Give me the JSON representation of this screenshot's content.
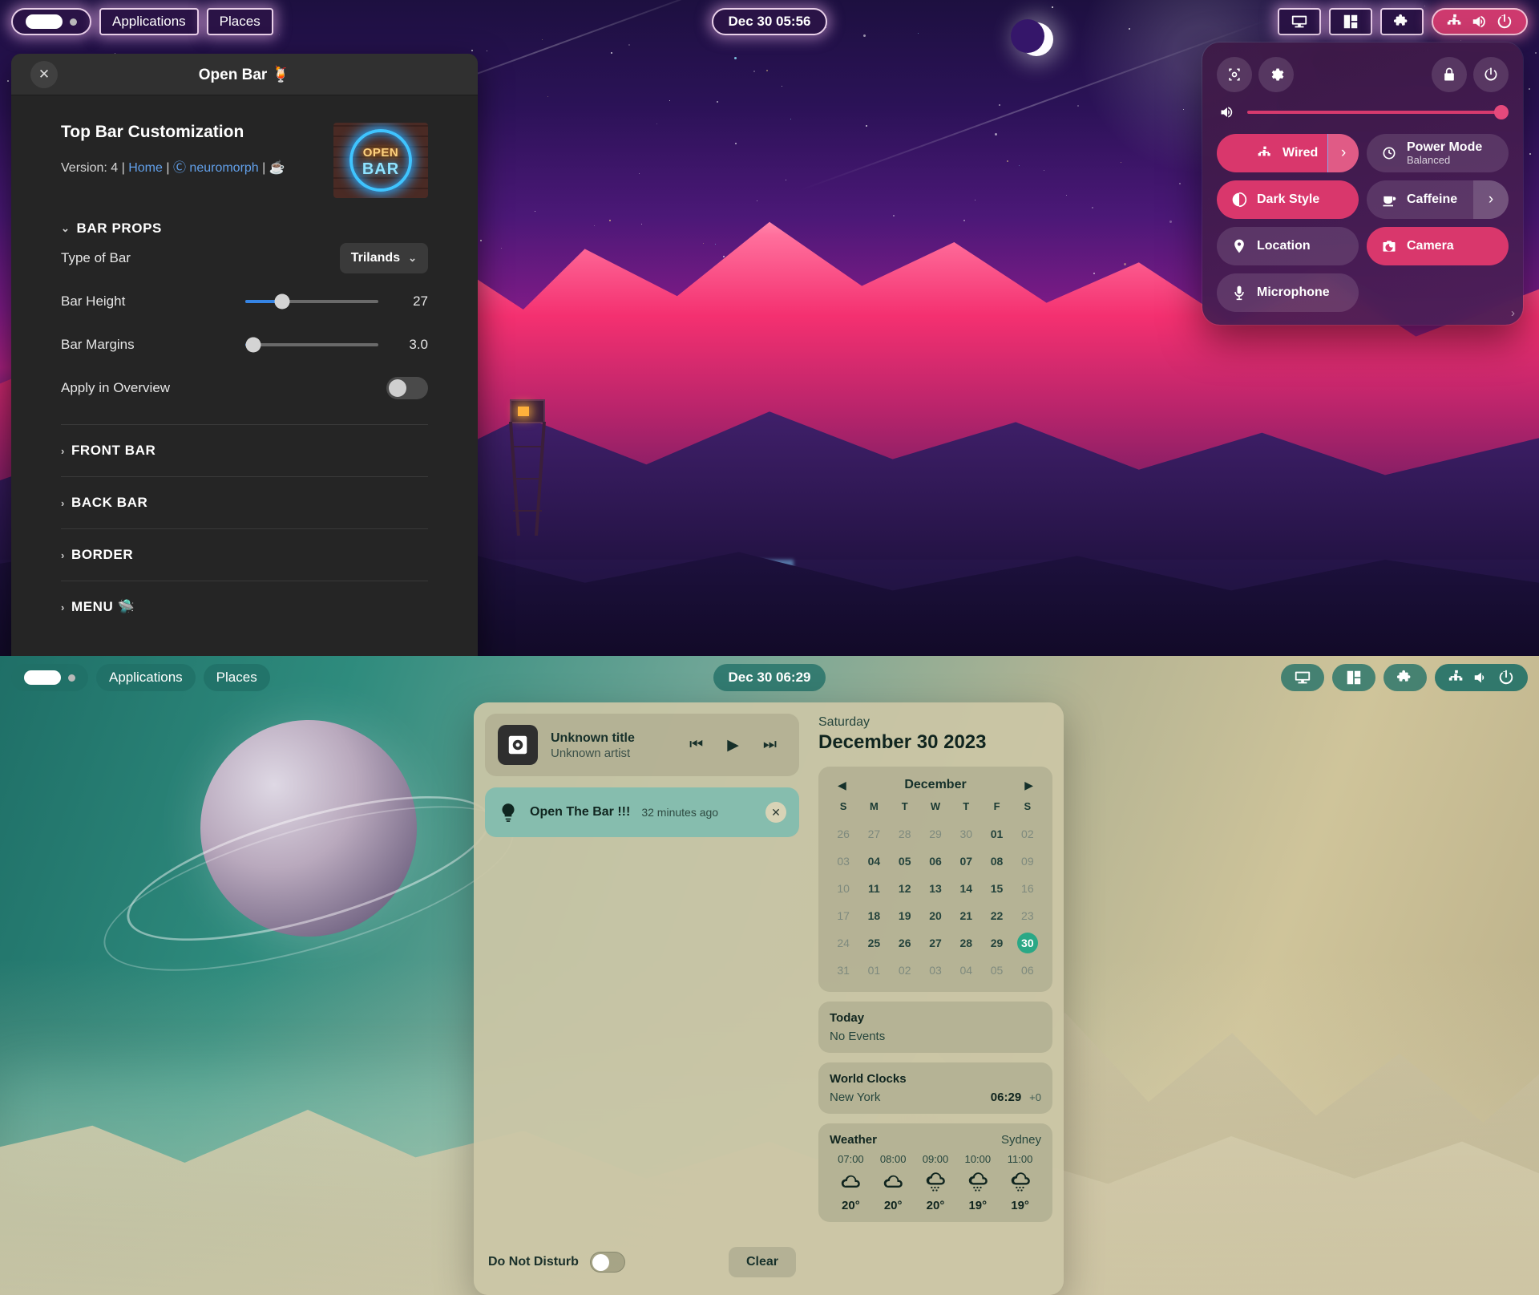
{
  "top_panel": {
    "activities_label": "",
    "applications_label": "Applications",
    "places_label": "Places",
    "clock": "Dec 30  05:56",
    "right_icons": [
      "display-icon",
      "window-layout-icon",
      "extensions-puzzle-icon",
      "wired-network-icon",
      "volume-icon",
      "power-icon"
    ]
  },
  "bottom_panel": {
    "applications_label": "Applications",
    "places_label": "Places",
    "clock": "Dec 30  06:29"
  },
  "openbar": {
    "window_title": "Open Bar 🍹",
    "close_label": "✕",
    "heading": "Top Bar Customization",
    "version_label": "Version: 4",
    "home_link": "Home",
    "copyright": "Ⓒ neuromorph",
    "coffee": "☕",
    "separator": "|",
    "sections": [
      {
        "id": "bar-props",
        "label": "BAR PROPS",
        "expanded": true,
        "chevron": "⌄"
      },
      {
        "id": "front-bar",
        "label": "FRONT BAR",
        "expanded": false,
        "chevron": "›"
      },
      {
        "id": "back-bar",
        "label": "BACK BAR",
        "expanded": false,
        "chevron": "›"
      },
      {
        "id": "border",
        "label": "BORDER",
        "expanded": false,
        "chevron": "›"
      },
      {
        "id": "menu",
        "label": "MENU 🛸",
        "expanded": false,
        "chevron": "›"
      }
    ],
    "type_of_bar": {
      "label": "Type of Bar",
      "value": "Trilands",
      "chevron": "⌄"
    },
    "bar_height": {
      "label": "Bar Height",
      "value": "27",
      "percent": 28
    },
    "bar_margins": {
      "label": "Bar Margins",
      "value": "3.0",
      "percent": 6
    },
    "apply_in_overview": {
      "label": "Apply in Overview",
      "enabled": false
    },
    "logo": {
      "line1": "OPEN",
      "line2": "BAR"
    }
  },
  "quick_settings": {
    "screenshot_label": "screenshot-icon",
    "settings_label": "gear-icon",
    "lock_label": "lock-icon",
    "power_label": "power-icon",
    "volume_percent": 100,
    "tiles": [
      {
        "id": "wired",
        "label": "Wired",
        "sub": "",
        "icon": "wired-network-icon",
        "active": true,
        "arrow": true
      },
      {
        "id": "power-mode",
        "label": "Power Mode",
        "sub": "Balanced",
        "icon": "power-mode-icon",
        "active": false,
        "arrow": false
      },
      {
        "id": "dark-style",
        "label": "Dark Style",
        "sub": "",
        "icon": "contrast-icon",
        "active": true,
        "arrow": false
      },
      {
        "id": "caffeine",
        "label": "Caffeine",
        "sub": "",
        "icon": "coffee-icon",
        "active": false,
        "arrow": true
      },
      {
        "id": "location",
        "label": "Location",
        "sub": "",
        "icon": "pin-icon",
        "active": false,
        "arrow": false
      },
      {
        "id": "camera",
        "label": "Camera",
        "sub": "",
        "icon": "camera-icon",
        "active": true,
        "arrow": false
      },
      {
        "id": "microphone",
        "label": "Microphone",
        "sub": "",
        "icon": "microphone-icon",
        "active": false,
        "arrow": false
      }
    ],
    "more_chevron": "›"
  },
  "tray": {
    "media": {
      "title": "Unknown title",
      "artist": "Unknown artist",
      "prev": "⏮",
      "play": "▶",
      "next": "⏭"
    },
    "notification": {
      "title": "Open The Bar !!!",
      "time": "32 minutes ago",
      "close": "✕"
    },
    "do_not_disturb": {
      "label": "Do Not Disturb",
      "enabled": false
    },
    "clear_label": "Clear"
  },
  "calendar": {
    "weekday": "Saturday",
    "date": "December 30 2023",
    "month": "December",
    "prev_arrow": "◀",
    "next_arrow": "▶",
    "weekday_headers": [
      "S",
      "M",
      "T",
      "W",
      "T",
      "F",
      "S"
    ],
    "weeks": [
      [
        {
          "d": "26",
          "dim": true
        },
        {
          "d": "27",
          "dim": true
        },
        {
          "d": "28",
          "dim": true
        },
        {
          "d": "29",
          "dim": true
        },
        {
          "d": "30",
          "dim": true
        },
        {
          "d": "01",
          "dim": false
        },
        {
          "d": "02",
          "dim": true
        }
      ],
      [
        {
          "d": "03",
          "dim": true
        },
        {
          "d": "04",
          "dim": false
        },
        {
          "d": "05",
          "dim": false
        },
        {
          "d": "06",
          "dim": false
        },
        {
          "d": "07",
          "dim": false
        },
        {
          "d": "08",
          "dim": false
        },
        {
          "d": "09",
          "dim": true
        }
      ],
      [
        {
          "d": "10",
          "dim": true
        },
        {
          "d": "11",
          "dim": false
        },
        {
          "d": "12",
          "dim": false
        },
        {
          "d": "13",
          "dim": false
        },
        {
          "d": "14",
          "dim": false
        },
        {
          "d": "15",
          "dim": false
        },
        {
          "d": "16",
          "dim": true
        }
      ],
      [
        {
          "d": "17",
          "dim": true
        },
        {
          "d": "18",
          "dim": false
        },
        {
          "d": "19",
          "dim": false
        },
        {
          "d": "20",
          "dim": false
        },
        {
          "d": "21",
          "dim": false
        },
        {
          "d": "22",
          "dim": false
        },
        {
          "d": "23",
          "dim": true
        }
      ],
      [
        {
          "d": "24",
          "dim": true
        },
        {
          "d": "25",
          "dim": false
        },
        {
          "d": "26",
          "dim": false
        },
        {
          "d": "27",
          "dim": false
        },
        {
          "d": "28",
          "dim": false
        },
        {
          "d": "29",
          "dim": false
        },
        {
          "d": "30",
          "dim": false,
          "today": true
        }
      ],
      [
        {
          "d": "31",
          "dim": true
        },
        {
          "d": "01",
          "dim": true
        },
        {
          "d": "02",
          "dim": true
        },
        {
          "d": "03",
          "dim": true
        },
        {
          "d": "04",
          "dim": true
        },
        {
          "d": "05",
          "dim": true
        },
        {
          "d": "06",
          "dim": true
        }
      ]
    ],
    "today": {
      "title": "Today",
      "text": "No Events"
    },
    "world_clocks": {
      "title": "World Clocks",
      "city": "New York",
      "time": "06:29",
      "offset": "+0"
    },
    "weather": {
      "title": "Weather",
      "location": "Sydney",
      "hours": [
        "07:00",
        "08:00",
        "09:00",
        "10:00",
        "11:00"
      ],
      "icons": [
        "cloud",
        "cloud",
        "rain",
        "rain",
        "rain"
      ],
      "temps": [
        "20°",
        "20°",
        "20°",
        "19°",
        "19°"
      ]
    }
  }
}
